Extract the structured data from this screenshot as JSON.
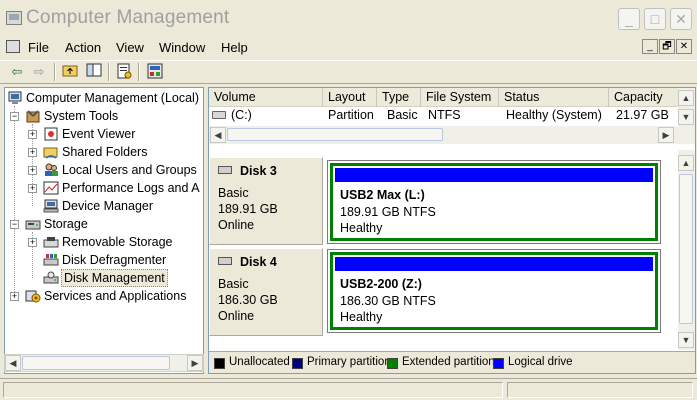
{
  "window": {
    "title": "Computer Management",
    "controls": {
      "minimize": "_",
      "maximize": "□",
      "close": "✕"
    }
  },
  "menu": [
    "File",
    "Action",
    "View",
    "Window",
    "Help"
  ],
  "mdi_controls": [
    "_",
    "🗗",
    "✕"
  ],
  "toolbar": {
    "buttons": [
      "back-icon",
      "forward-icon",
      "up-folder-icon",
      "show-hide-tree-icon",
      "help-icon",
      "properties-icon"
    ]
  },
  "tree": {
    "items": [
      {
        "label": "Computer Management (Local)",
        "icon": "computer-icon"
      },
      {
        "label": "System Tools",
        "icon": "tools-icon"
      },
      {
        "label": "Event Viewer",
        "icon": "event-viewer-icon"
      },
      {
        "label": "Shared Folders",
        "icon": "shared-folder-icon"
      },
      {
        "label": "Local Users and Groups",
        "icon": "users-icon"
      },
      {
        "label": "Performance Logs and A",
        "icon": "perf-logs-icon"
      },
      {
        "label": "Device Manager",
        "icon": "device-manager-icon"
      },
      {
        "label": "Storage",
        "icon": "storage-icon"
      },
      {
        "label": "Removable Storage",
        "icon": "removable-storage-icon"
      },
      {
        "label": "Disk Defragmenter",
        "icon": "defrag-icon"
      },
      {
        "label": "Disk Management",
        "icon": "disk-management-icon"
      },
      {
        "label": "Services and Applications",
        "icon": "services-icon"
      }
    ],
    "selected": "Disk Management"
  },
  "volume_list": {
    "columns": [
      "Volume",
      "Layout",
      "Type",
      "File System",
      "Status",
      "Capacity"
    ],
    "rows": [
      {
        "volume": "(C:)",
        "layout": "Partition",
        "type": "Basic",
        "fs": "NTFS",
        "status": "Healthy (System)",
        "capacity": "21.97 GB"
      }
    ]
  },
  "disks": [
    {
      "name": "Disk 3",
      "type": "Basic",
      "size": "189.91 GB",
      "state": "Online",
      "partition": {
        "name": "USB2 Max  (L:)",
        "detail": "189.91 GB NTFS",
        "status": "Healthy"
      }
    },
    {
      "name": "Disk 4",
      "type": "Basic",
      "size": "186.30 GB",
      "state": "Online",
      "partition": {
        "name": "USB2-200  (Z:)",
        "detail": "186.30 GB NTFS",
        "status": "Healthy"
      }
    }
  ],
  "legend": [
    {
      "label": "Unallocated",
      "color": "#000000"
    },
    {
      "label": "Primary partition",
      "color": "#000080"
    },
    {
      "label": "Extended partition",
      "color": "#008000"
    },
    {
      "label": "Logical drive",
      "color": "#0000ff"
    }
  ]
}
